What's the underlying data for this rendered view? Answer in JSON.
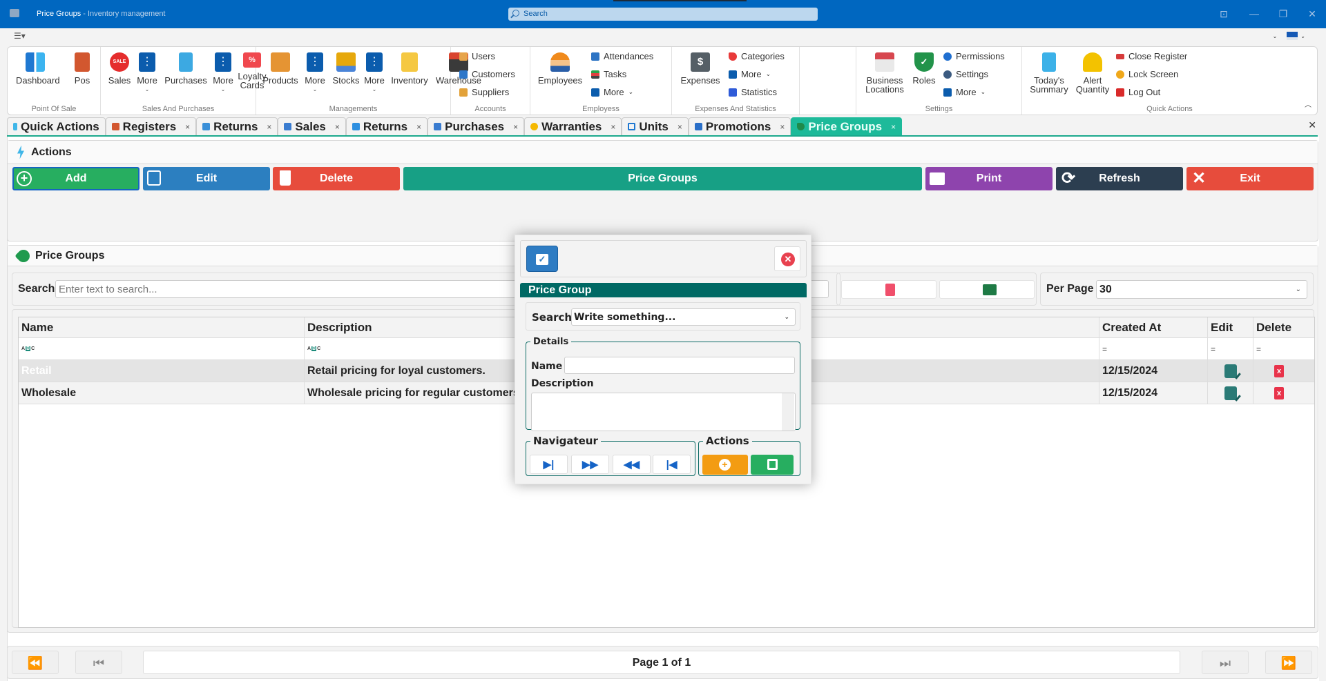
{
  "window": {
    "title": "Price Groups",
    "subtitle": " - Inventory management",
    "search_placeholder": "Search",
    "controls": [
      "pin-icon",
      "minimize-icon",
      "restore-icon",
      "close-icon"
    ]
  },
  "ribbon": {
    "groups": [
      {
        "label": "Point Of Sale",
        "items": [
          {
            "label": "Dashboard",
            "icon": "dashboard-icon"
          },
          {
            "label": "Pos",
            "icon": "cash-register-icon"
          }
        ]
      },
      {
        "label": "Sales And Purchases",
        "items": [
          {
            "label": "Sales",
            "icon": "sale-badge-icon"
          },
          {
            "label": "More",
            "icon": "more-icon"
          },
          {
            "label": "Purchases",
            "icon": "receipt-icon"
          },
          {
            "label": "More",
            "icon": "more-icon"
          },
          {
            "label": "Loyalty Cards",
            "icon": "percent-icon"
          }
        ]
      },
      {
        "label": "Managements",
        "items": [
          {
            "label": "Products",
            "icon": "box-icon"
          },
          {
            "label": "More",
            "icon": "more-icon"
          },
          {
            "label": "Stocks",
            "icon": "cart-icon"
          },
          {
            "label": "More",
            "icon": "more-icon"
          },
          {
            "label": "Inventory",
            "icon": "inventory-icon"
          },
          {
            "label": "Warehouse",
            "icon": "warehouse-icon"
          }
        ]
      },
      {
        "label": "Accounts",
        "items": [
          {
            "label": "Users",
            "icon": "users-icon"
          },
          {
            "label": "Customers",
            "icon": "customers-icon"
          },
          {
            "label": "Suppliers",
            "icon": "supplier-icon"
          }
        ]
      },
      {
        "label": "Employess",
        "items": [
          {
            "label": "Employees",
            "icon": "worker-icon"
          },
          {
            "label": "Attendances",
            "icon": "attendance-icon"
          },
          {
            "label": "Tasks",
            "icon": "tasks-icon"
          },
          {
            "label": "More",
            "icon": "more-icon"
          }
        ]
      },
      {
        "label": "Expenses And Statistics",
        "items": [
          {
            "label": "Expenses",
            "icon": "money-bag-icon"
          },
          {
            "label": "Categories",
            "icon": "tag-icon"
          },
          {
            "label": "More",
            "icon": "more-icon"
          },
          {
            "label": "Statistics",
            "icon": "chart-icon"
          }
        ]
      },
      {
        "label": "Settings",
        "items": [
          {
            "label": "Business Locations",
            "icon": "store-icon"
          },
          {
            "label": "Roles",
            "icon": "shield-icon"
          },
          {
            "label": "Permissions",
            "icon": "permissions-icon"
          },
          {
            "label": "Settings",
            "icon": "gear-icon"
          },
          {
            "label": "More",
            "icon": "more-icon"
          }
        ]
      },
      {
        "label": "Quick Actions",
        "items": [
          {
            "label": "Today's Summary",
            "icon": "summary-icon"
          },
          {
            "label": "Alert Quantity",
            "icon": "bell-icon"
          },
          {
            "label": "Close Register",
            "icon": "register-icon"
          },
          {
            "label": "Lock Screen",
            "icon": "lock-icon"
          },
          {
            "label": "Log Out",
            "icon": "alarm-icon"
          }
        ]
      }
    ]
  },
  "tabs": [
    {
      "label": "Quick Actions",
      "closable": false,
      "active": false
    },
    {
      "label": "Registers",
      "closable": true,
      "active": false
    },
    {
      "label": "Returns",
      "closable": true,
      "active": false
    },
    {
      "label": "Sales",
      "closable": true,
      "active": false
    },
    {
      "label": "Returns",
      "closable": true,
      "active": false
    },
    {
      "label": "Purchases",
      "closable": true,
      "active": false
    },
    {
      "label": "Warranties",
      "closable": true,
      "active": false
    },
    {
      "label": "Units",
      "closable": true,
      "active": false
    },
    {
      "label": "Promotions",
      "closable": true,
      "active": false
    },
    {
      "label": "Price Groups",
      "closable": true,
      "active": true
    }
  ],
  "actions": {
    "title": "Actions",
    "buttons": {
      "add": "Add",
      "edit": "Edit",
      "delete": "Delete",
      "center": "Price Groups",
      "print": "Print",
      "refresh": "Refresh",
      "exit": "Exit"
    },
    "colors": {
      "add": "#27ae60",
      "edit": "#2c7fc0",
      "delete": "#e74c3c",
      "center": "#17a085",
      "print": "#8e44ad",
      "refresh": "#2c3e50",
      "exit": "#e74c3c"
    }
  },
  "panel": {
    "title": "Price Groups",
    "search_label": "Search",
    "search_placeholder": "Enter text to search...",
    "per_page_label": "Per Page",
    "per_page_value": "30",
    "columns": [
      "Name",
      "Description",
      "Created At",
      "Edit",
      "Delete"
    ],
    "filter_row": [
      "abc-filter",
      "abc-filter",
      "=",
      "=",
      "="
    ],
    "rows": [
      {
        "name": "Retail",
        "description": "Retail pricing for loyal customers.",
        "created_at": "12/15/2024"
      },
      {
        "name": "Wholesale",
        "description": "Wholesale pricing for regular customers",
        "created_at": "12/15/2024"
      }
    ]
  },
  "pager": {
    "info": "Page 1 of 1"
  },
  "modal": {
    "header": "Price Group",
    "search_label": "Search",
    "search_value": "Write something...",
    "details_legend": "Details",
    "name_label": "Name",
    "name_value": "",
    "description_label": "Description",
    "description_value": "",
    "navigator_legend": "Navigateur",
    "actions_legend": "Actions"
  }
}
